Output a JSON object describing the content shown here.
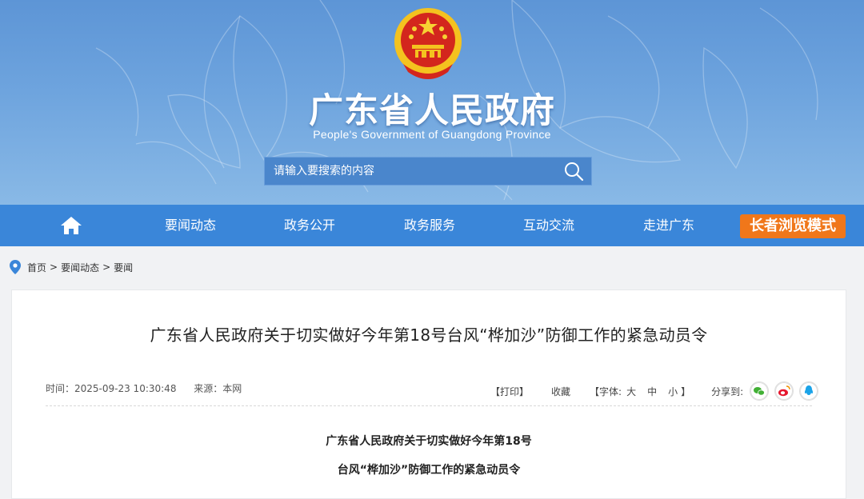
{
  "header": {
    "title": "广东省人民政府",
    "subtitle": "People's Government of Guangdong Province",
    "search_placeholder": "请输入要搜索的内容"
  },
  "nav": {
    "items": [
      {
        "label": "要闻动态"
      },
      {
        "label": "政务公开"
      },
      {
        "label": "政务服务"
      },
      {
        "label": "互动交流"
      },
      {
        "label": "走进广东"
      }
    ],
    "elder_mode": "长者浏览模式"
  },
  "breadcrumb": [
    "首页",
    "要闻动态",
    "要闻"
  ],
  "article": {
    "title": "广东省人民政府关于切实做好今年第18号台风“桦加沙”防御工作的紧急动员令",
    "time": "时间：2025-09-23 10:30:48",
    "source": "来源：本网",
    "print": "【打印】",
    "favorite": "收藏",
    "font_open": "【字体:",
    "font_large": "大",
    "font_medium": "中",
    "font_small": "小",
    "font_close": "】",
    "share_label": "分享到:",
    "body_line1": "广东省人民政府关于切实做好今年第18号",
    "body_line2": "台风“桦加沙”防御工作的紧急动员令"
  },
  "colors": {
    "nav_bg": "#3a86d9",
    "elder_btn": "#f0771a",
    "header_bg": "#6ea4de"
  },
  "icons": [
    "home-icon",
    "search-icon",
    "location-pin-icon",
    "wechat-icon",
    "weibo-icon",
    "qq-icon"
  ]
}
